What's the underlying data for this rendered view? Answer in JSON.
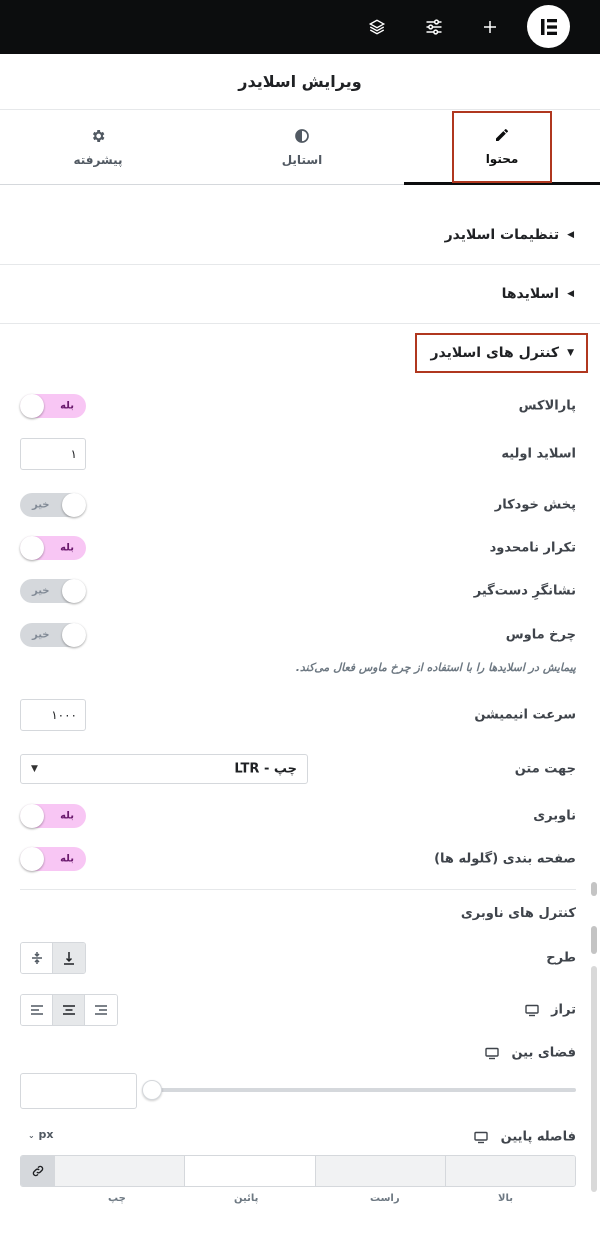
{
  "header": {
    "title": "ویرایش اسلایدر"
  },
  "tabs": [
    {
      "label": "محتوا"
    },
    {
      "label": "استایل"
    },
    {
      "label": "پیشرفته"
    }
  ],
  "sections": {
    "settings": "تنظیمات اسلایدر",
    "slides": "اسلایدها",
    "controls": "کنترل های اسلایدر"
  },
  "controls": {
    "parallax": {
      "label": "پارالاکس",
      "state": "بله"
    },
    "initial_slide": {
      "label": "اسلاید اولیه",
      "value": "۱"
    },
    "autoplay": {
      "label": "پخش خودکار",
      "state": "خیر"
    },
    "infinite": {
      "label": "تکرار نامحدود",
      "state": "بله"
    },
    "grab_cursor": {
      "label": "نشانگرِ دست‌گیر",
      "state": "خیر"
    },
    "mousewheel": {
      "label": "چرخ ماوس",
      "state": "خیر"
    },
    "mousewheel_desc": "پیمایش در اسلایدها را با استفاده از چرخ ماوس فعال می‌کند.",
    "speed": {
      "label": "سرعت انیمیشن",
      "value": "۱۰۰۰"
    },
    "direction": {
      "label": "جهت متن",
      "value": "چپ - LTR"
    },
    "navigation": {
      "label": "ناوبری",
      "state": "بله"
    },
    "pagination": {
      "label": "صفحه بندی (گلوله ها)",
      "state": "بله"
    }
  },
  "nav_controls": {
    "heading": "کنترل های ناوبری",
    "layout_label": "طرح",
    "align_label": "تراز",
    "spacing_label": "فضای بین",
    "bottom_label": "فاصله پایین",
    "unit": "px",
    "dims": [
      "بالا",
      "راست",
      "پائین",
      "چپ"
    ]
  },
  "colors": {
    "toggle_on": "#f8c6f4",
    "toggle_off": "#d5d8dc",
    "highlight": "#b0371f",
    "topbar": "#0c0d0e"
  }
}
